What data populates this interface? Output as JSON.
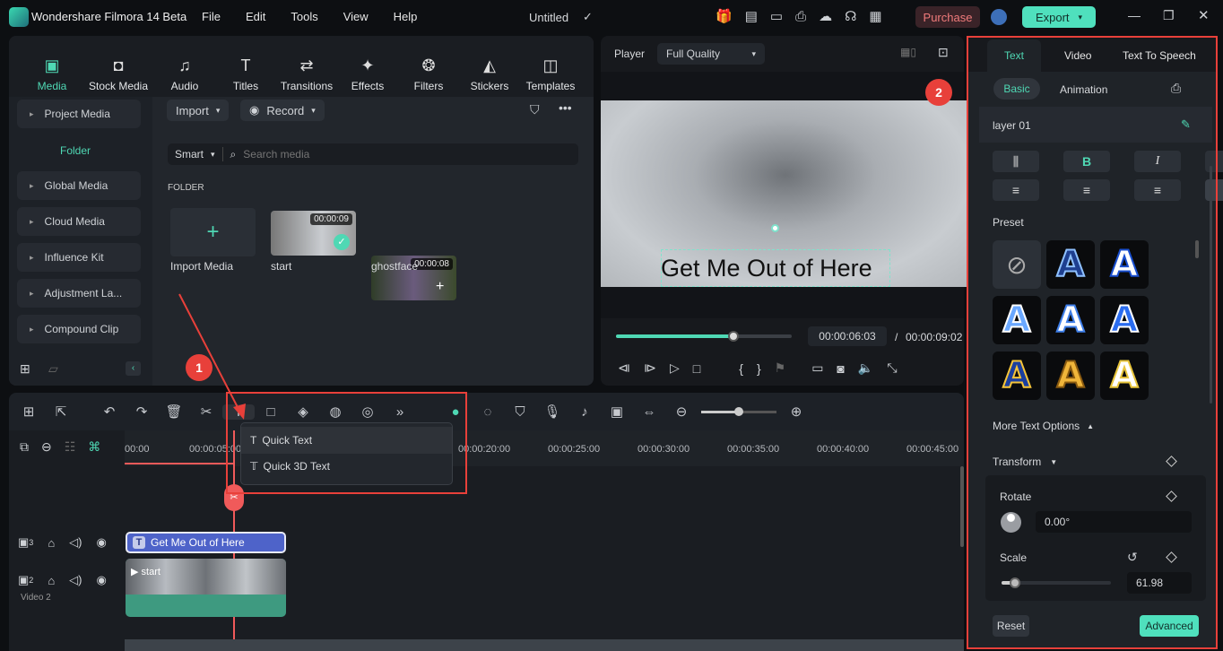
{
  "app": {
    "title": "Wondershare Filmora 14 Beta",
    "menu": [
      "File",
      "Edit",
      "Tools",
      "View",
      "Help"
    ],
    "project": "Untitled",
    "purchase": "Purchase",
    "export": "Export"
  },
  "media_tabs": [
    {
      "label": "Media",
      "icon": "media-icon",
      "active": true
    },
    {
      "label": "Stock Media",
      "icon": "stock-media-icon"
    },
    {
      "label": "Audio",
      "icon": "music-note-icon"
    },
    {
      "label": "Titles",
      "icon": "titles-icon"
    },
    {
      "label": "Transitions",
      "icon": "transitions-icon"
    },
    {
      "label": "Effects",
      "icon": "effects-icon"
    },
    {
      "label": "Filters",
      "icon": "filters-icon"
    },
    {
      "label": "Stickers",
      "icon": "stickers-icon"
    },
    {
      "label": "Templates",
      "icon": "templates-icon"
    }
  ],
  "sidebar": {
    "project_media": "Project Media",
    "folder": "Folder",
    "items": [
      "Global Media",
      "Cloud Media",
      "Influence Kit",
      "Adjustment La...",
      "Compound Clip"
    ]
  },
  "media": {
    "import": "Import",
    "record": "Record",
    "smart": "Smart",
    "search_placeholder": "Search media",
    "section": "FOLDER",
    "import_media": "Import Media",
    "items": [
      {
        "name": "start",
        "duration": "00:00:09"
      },
      {
        "name": "ghostface",
        "duration": "00:00:08"
      }
    ]
  },
  "player": {
    "label": "Player",
    "quality": "Full Quality",
    "overlay_text": "Get Me Out of Here",
    "current_time": "00:00:06:03",
    "total_time": "00:00:09:02",
    "progress": 0.67
  },
  "timeline": {
    "ruler": [
      "00:00",
      "00:00:05:00",
      "00:00:20:00",
      "00:00:25:00",
      "00:00:30:00",
      "00:00:35:00",
      "00:00:40:00",
      "00:00:45:00"
    ],
    "dropdown": [
      "Quick Text",
      "Quick 3D Text"
    ],
    "tracks": [
      {
        "num": "3",
        "clip": "Get Me Out of Here"
      },
      {
        "num": "2",
        "clip": "start",
        "name": "Video 2"
      }
    ],
    "zoom_level": 0.5
  },
  "annotations": {
    "one": "1",
    "two": "2",
    "color": "#e8403a"
  },
  "right": {
    "tabs": [
      "Text",
      "Video",
      "Text To Speech"
    ],
    "subtabs": [
      "Basic",
      "Animation"
    ],
    "layer": "layer 01",
    "preset": "Preset",
    "more": "More Text Options",
    "transform": "Transform",
    "rotate": "Rotate",
    "rotate_value": "0.00°",
    "scale": "Scale",
    "scale_value": "61.98",
    "scale_fraction": 0.12,
    "reset": "Reset",
    "advanced": "Advanced"
  },
  "colors": {
    "accent": "#4fd8b4",
    "purchase": "#f07b7b",
    "clip_text": "#4e63c9",
    "clip_video": "#3e9a80",
    "playhead": "#f05a5a"
  }
}
